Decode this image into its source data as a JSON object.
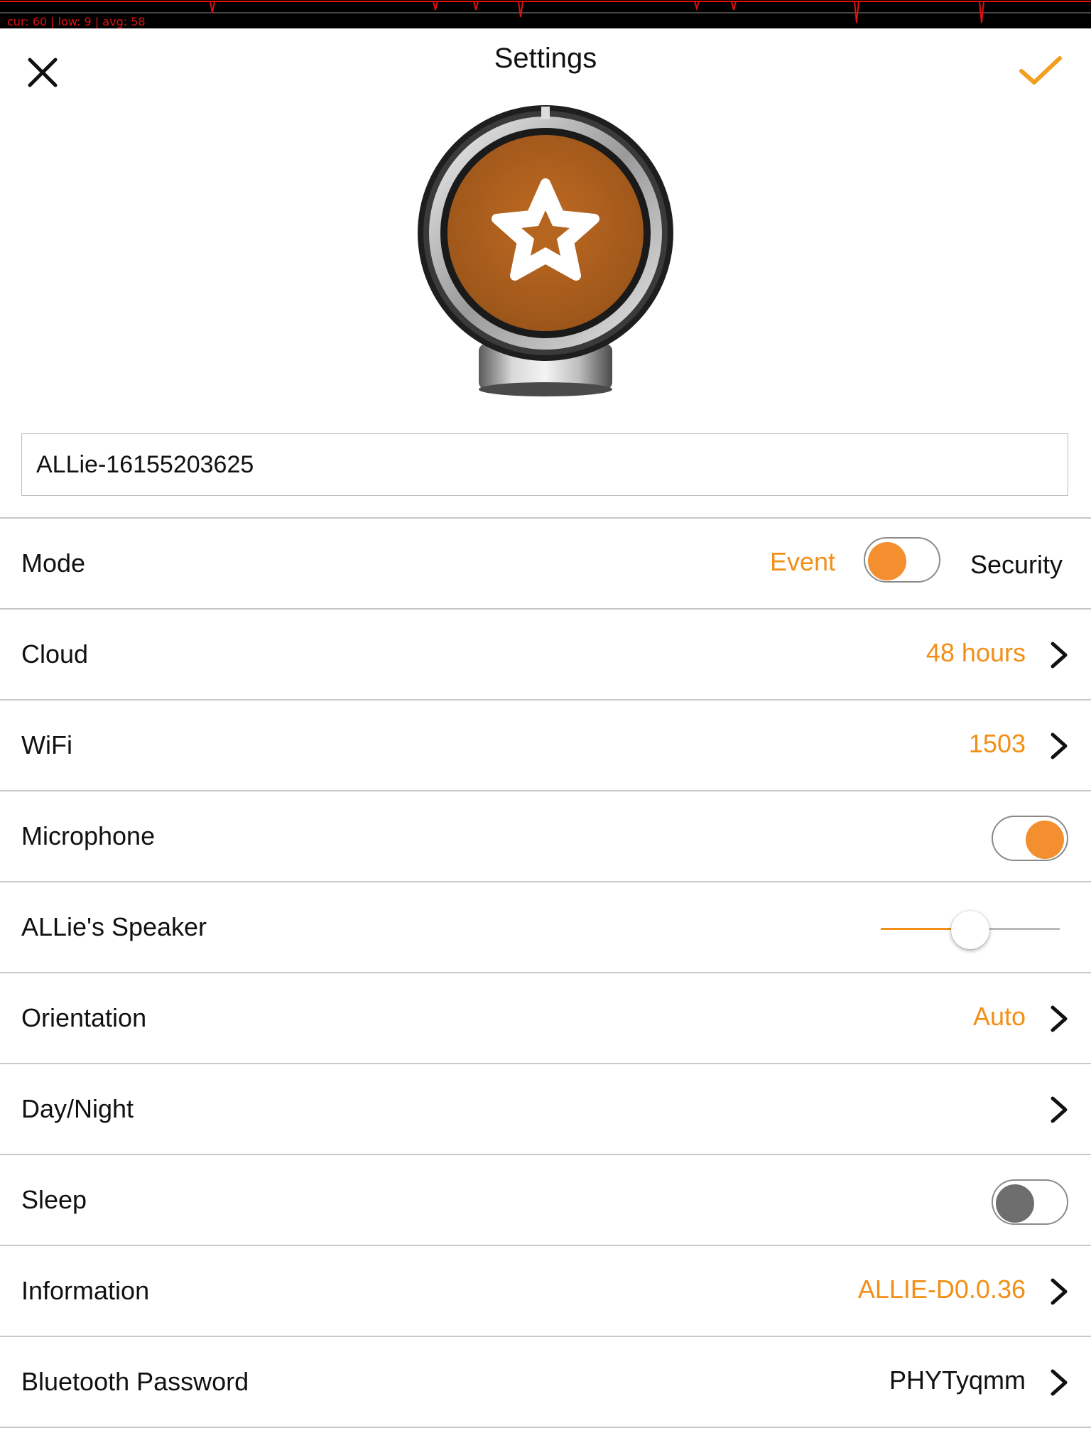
{
  "debug": {
    "stats": "cur: 60 | low: 9 | avg: 58"
  },
  "header": {
    "title": "Settings",
    "close_icon": "close-icon",
    "confirm_icon": "checkmark-icon"
  },
  "device": {
    "icon": "star-icon"
  },
  "device_name": {
    "value": "ALLie-16155203625"
  },
  "colors": {
    "accent": "#f28f17",
    "toggle_on": "#f38f2f",
    "toggle_off": "#6e6e6e",
    "divider": "#c8c8c8",
    "device_face": "#b5651f"
  },
  "settings": {
    "mode": {
      "label": "Mode",
      "option_left": "Event",
      "option_right": "Security",
      "selected": "Event"
    },
    "cloud": {
      "label": "Cloud",
      "value": "48 hours"
    },
    "wifi": {
      "label": "WiFi",
      "value": "1503"
    },
    "microphone": {
      "label": "Microphone",
      "enabled": true
    },
    "speaker": {
      "label": "ALLie's Speaker",
      "volume": 0.5
    },
    "orientation": {
      "label": "Orientation",
      "value": "Auto"
    },
    "day_night": {
      "label": "Day/Night"
    },
    "sleep": {
      "label": "Sleep",
      "enabled": false
    },
    "information": {
      "label": "Information",
      "value": "ALLIE-D0.0.36"
    },
    "bluetooth_password": {
      "label": "Bluetooth Password",
      "value": "PHYTyqmm"
    }
  }
}
